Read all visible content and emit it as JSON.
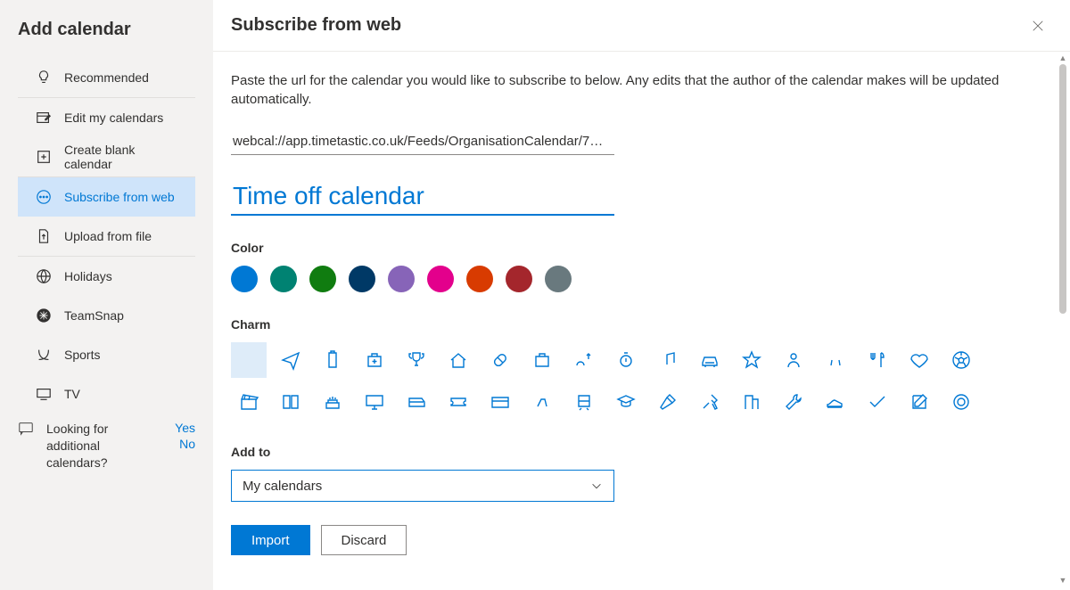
{
  "sidebar": {
    "title": "Add calendar",
    "groups": [
      [
        {
          "key": "recommended",
          "label": "Recommended",
          "icon": "lightbulb"
        }
      ],
      [
        {
          "key": "edit",
          "label": "Edit my calendars",
          "icon": "edit-calendar"
        },
        {
          "key": "create",
          "label": "Create blank calendar",
          "icon": "add-square"
        }
      ],
      [
        {
          "key": "subscribe",
          "label": "Subscribe from web",
          "icon": "subscribe",
          "selected": true
        },
        {
          "key": "upload",
          "label": "Upload from file",
          "icon": "upload-file"
        }
      ],
      [
        {
          "key": "holidays",
          "label": "Holidays",
          "icon": "globe"
        },
        {
          "key": "teamsnap",
          "label": "TeamSnap",
          "icon": "teamsnap"
        },
        {
          "key": "sports",
          "label": "Sports",
          "icon": "sports"
        },
        {
          "key": "tv",
          "label": "TV",
          "icon": "tv"
        }
      ]
    ],
    "feedback": {
      "question": "Looking for additional calendars?",
      "yes": "Yes",
      "no": "No"
    }
  },
  "main": {
    "title": "Subscribe from web",
    "description": "Paste the url for the calendar you would like to subscribe to below. Any edits that the author of the calendar makes will be updated automatically.",
    "url_value": "webcal://app.timetastic.co.uk/Feeds/OrganisationCalendar/7…",
    "name_value": "Time off calendar",
    "color_label": "Color",
    "colors": [
      "#0078d4",
      "#008272",
      "#107c10",
      "#003966",
      "#8764b8",
      "#e3008c",
      "#d83b01",
      "#a4262c",
      "#69797e"
    ],
    "charm_label": "Charm",
    "charms": [
      "none",
      "plane",
      "clipboard",
      "medkit",
      "trophy",
      "home",
      "pill",
      "briefcase",
      "people",
      "stopwatch",
      "music",
      "car",
      "star",
      "person",
      "balloons",
      "utensils",
      "heart",
      "soccer",
      "clapper",
      "book",
      "cake",
      "monitor",
      "bus",
      "ticket",
      "card",
      "bike",
      "train",
      "graduation",
      "hammer",
      "tools",
      "building",
      "wrench",
      "shoe",
      "check",
      "compose",
      "target"
    ],
    "selected_charm_index": 0,
    "addto_label": "Add to",
    "addto_value": "My calendars",
    "import_label": "Import",
    "discard_label": "Discard"
  }
}
